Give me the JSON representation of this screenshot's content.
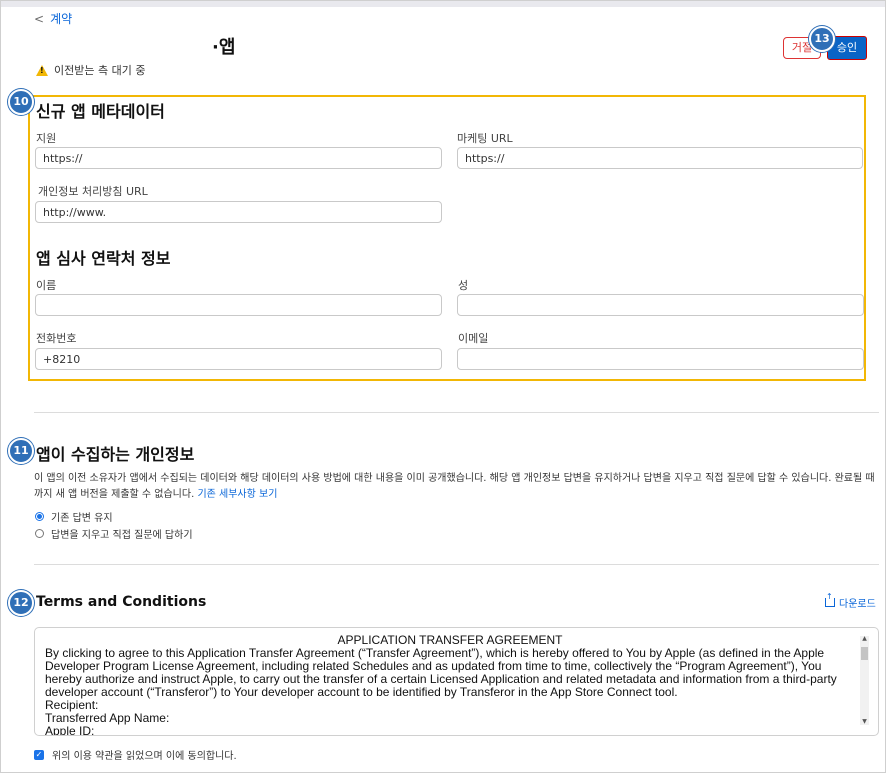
{
  "header": {
    "back_label": "계약",
    "app_title": "·앱",
    "pending_status": "이전받는 측 대기 중",
    "reject_label": "거절",
    "approve_label": "승인"
  },
  "badges": {
    "metadata": "10",
    "privacy": "11",
    "terms": "12",
    "approve": "13"
  },
  "metadata": {
    "heading": "신규 앱 메타데이터",
    "support_label": "지원",
    "support_value": "https://",
    "marketing_label": "마케팅 URL",
    "marketing_value": "https://",
    "privacy_url_label": "개인정보 처리방침 URL",
    "privacy_url_value": "http://www."
  },
  "review_contact": {
    "heading": "앱 심사 연락처 정보",
    "first_name_label": "이름",
    "first_name_value": "",
    "last_name_label": "성",
    "last_name_value": "",
    "phone_label": "전화번호",
    "phone_value": "+8210",
    "email_label": "이메일",
    "email_value": ""
  },
  "privacy": {
    "heading": "앱이 수집하는 개인정보",
    "description": "이 앱의 이전 소유자가 앱에서 수집되는 데이터와 해당 데이터의 사용 방법에 대한 내용을 이미 공개했습니다. 해당 앱 개인정보 답변을 유지하거나 답변을 지우고 직접 질문에 답할 수 있습니다. 완료될 때까지 새 앱 버전을 제출할 수 없습니다.",
    "details_link": "기존 세부사항 보기",
    "option_keep": "기존 답변 유지",
    "option_clear": "답변을 지우고 직접 질문에 답하기",
    "selected": "keep"
  },
  "terms": {
    "heading": "Terms and Conditions",
    "download_label": "다운로드",
    "doc_title": "APPLICATION TRANSFER AGREEMENT",
    "body": "By clicking to agree to this Application Transfer Agreement (“Transfer Agreement”), which is hereby offered to You by Apple (as defined in the Apple Developer Program License Agreement, including related Schedules and as updated from time to time, collectively the “Program Agreement”), You hereby authorize and instruct Apple, to carry out the transfer of a certain Licensed Application and related metadata and information from a third-party developer account (“Transferor”) to Your developer account to be identified by Transferor in the App Store Connect tool.",
    "recipient": "Recipient:",
    "transferred_app": "Transferred App Name:",
    "apple_id": "Apple ID:",
    "agree_label": "위의 이용 약관을 읽었으며 이에 동의합니다.",
    "agreed": true
  },
  "colors": {
    "accent": "#0a66d8",
    "highlight_border": "#f2b705",
    "badge": "#2f6fb7",
    "reject": "#dd3333",
    "approve_bg": "#0a64c6"
  }
}
